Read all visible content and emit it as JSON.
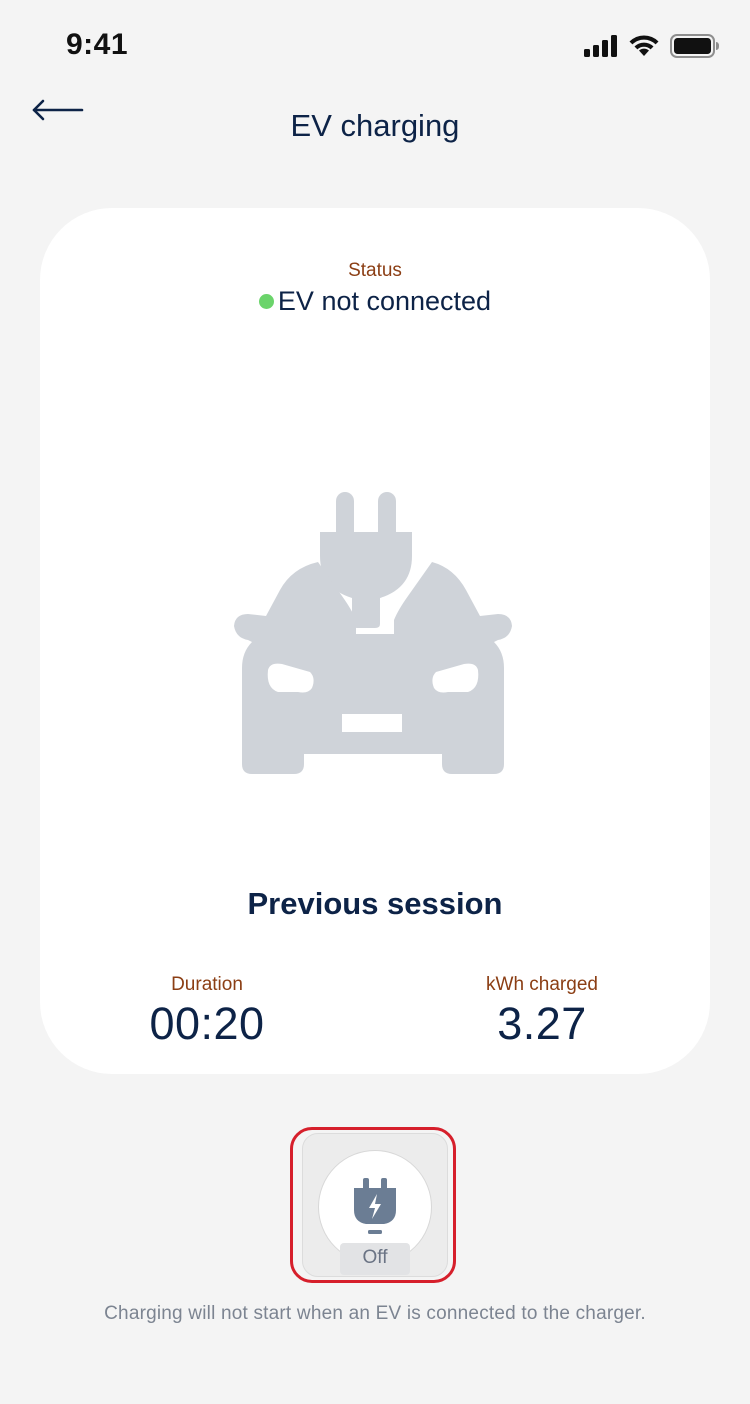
{
  "status_bar": {
    "time": "9:41",
    "icons": [
      "cellular-signal-icon",
      "wifi-icon",
      "battery-icon"
    ]
  },
  "header": {
    "back_icon": "arrow-left-icon",
    "title": "EV charging"
  },
  "card": {
    "status_label": "Status",
    "status_value": "EV not connected",
    "status_color": "#6bd46b",
    "illustration": "car-with-plug-icon",
    "previous_session_title": "Previous session",
    "stats": [
      {
        "label": "Duration",
        "value": "00:20"
      },
      {
        "label": "kWh charged",
        "value": "3.27"
      }
    ]
  },
  "charge_toggle": {
    "icon": "plug-bolt-icon",
    "state_label": "Off",
    "highlight_color": "#d61f2b"
  },
  "hint_text": "Charging will not start when an EV is connected to the charger.",
  "colors": {
    "background": "#f4f4f4",
    "primary_text": "#0d2347",
    "label_accent": "#8b3e14",
    "illustration_gray": "#cfd3d9"
  }
}
